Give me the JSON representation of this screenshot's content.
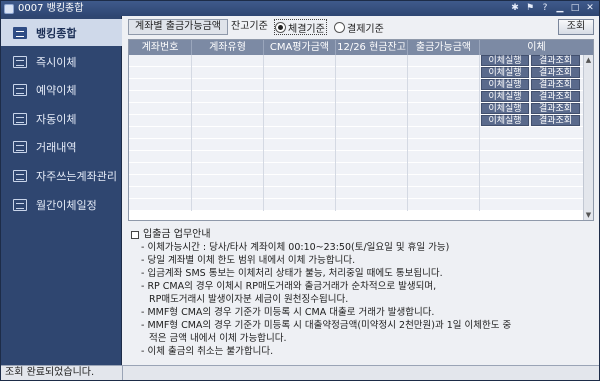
{
  "window": {
    "title": "0007 뱅킹종합"
  },
  "sidebar": {
    "items": [
      {
        "label": "뱅킹종합",
        "icon": "bank-icon",
        "active": true
      },
      {
        "label": "즉시이체",
        "icon": "transfer-icon",
        "active": false
      },
      {
        "label": "예약이체",
        "icon": "reserve-transfer-icon",
        "active": false
      },
      {
        "label": "자동이체",
        "icon": "auto-transfer-icon",
        "active": false
      },
      {
        "label": "거래내역",
        "icon": "history-icon",
        "active": false
      },
      {
        "label": "자주쓰는계좌관리",
        "icon": "favorite-account-icon",
        "active": false
      },
      {
        "label": "월간이체일정",
        "icon": "calendar-icon",
        "active": false
      }
    ]
  },
  "toolbar": {
    "section_label": "계좌별 출금가능금액",
    "balance_basis_label": "잔고기준",
    "radio_options": [
      {
        "label": "체결기준",
        "selected": true
      },
      {
        "label": "결제기준",
        "selected": false
      }
    ],
    "search_label": "조회"
  },
  "table": {
    "columns": [
      "계좌번호",
      "계좌유형",
      "CMA평가금액",
      "12/26 현금잔고",
      "출금가능금액",
      "이체"
    ],
    "action_buttons": {
      "transfer": "이체실행",
      "result": "결과조회"
    },
    "action_rows": 6,
    "total_rows": 13
  },
  "notice": {
    "title": "입출금 업무안내",
    "lines": [
      {
        "text": "- 이체가능시간 : 당사/타사 계좌이체 00:10~23:50(토/일요일 및 휴일 가능)",
        "cont": false
      },
      {
        "text": "- 당일 계좌별 이체 한도 범위 내에서 이체 가능합니다.",
        "cont": false
      },
      {
        "text": "- 입금계좌 SMS 통보는 이체처리 상태가 불능, 처리중일 때에도 통보됩니다.",
        "cont": false
      },
      {
        "text": "- RP CMA의 경우 이체시 RP매도거래와 출금거래가 순차적으로 발생되며,",
        "cont": false
      },
      {
        "text": "RP매도거래시 발생이자분 세금이 원천징수됩니다.",
        "cont": true
      },
      {
        "text": "- MMF형 CMA의 경우 기준가 미등록 시 CMA 대출로 거래가 발생합니다.",
        "cont": false
      },
      {
        "text": "- MMF형 CMA의 경우 기준가 미등록 시 대출약정금액(미약정시 2천만원)과 1일 이체한도 중",
        "cont": false
      },
      {
        "text": "적은 금액 내에서 이체 가능합니다.",
        "cont": true
      },
      {
        "text": "- 이체 출금의 취소는 불가합니다.",
        "cont": false
      }
    ]
  },
  "status": {
    "message": "조회 완료되었습니다."
  },
  "colors": {
    "sidebar_bg": "#2f4670",
    "header_bg": "#7c8aa4",
    "button_bg": "#5a6a8c"
  }
}
